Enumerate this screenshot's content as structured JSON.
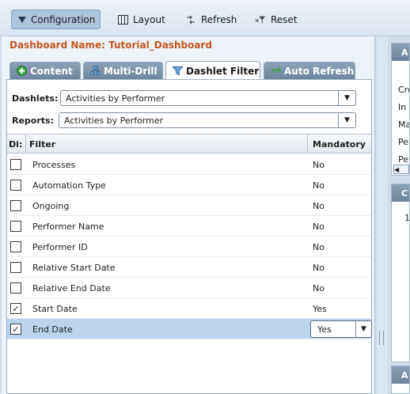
{
  "toolbar": {
    "configuration": "Configuration",
    "layout": "Layout",
    "refresh": "Refresh",
    "reset": "Reset"
  },
  "dashboard_name": "Dashboard Name: Tutorial_Dashboard",
  "tabs": [
    {
      "label": "Content"
    },
    {
      "label": "Multi-Drill"
    },
    {
      "label": "Dashlet Filter"
    },
    {
      "label": "Auto Refresh"
    }
  ],
  "form": {
    "dashlets_label": "Dashlets:",
    "dashlets_value": "Activities by Performer",
    "reports_label": "Reports:",
    "reports_value": "Activities by Performer"
  },
  "grid": {
    "col_display": "Di:",
    "col_filter": "Filter",
    "col_mandatory": "Mandatory",
    "rows": [
      {
        "filter": "Processes",
        "mandatory": "No",
        "checked": false
      },
      {
        "filter": "Automation Type",
        "mandatory": "No",
        "checked": false
      },
      {
        "filter": "Ongoing",
        "mandatory": "No",
        "checked": false
      },
      {
        "filter": "Performer Name",
        "mandatory": "No",
        "checked": false
      },
      {
        "filter": "Performer ID",
        "mandatory": "No",
        "checked": false
      },
      {
        "filter": "Relative Start Date",
        "mandatory": "No",
        "checked": false
      },
      {
        "filter": "Relative End Date",
        "mandatory": "No",
        "checked": false
      },
      {
        "filter": "Start Date",
        "mandatory": "Yes",
        "checked": true
      },
      {
        "filter": "End Date",
        "mandatory": "Yes",
        "checked": true
      }
    ]
  },
  "right_panel": {
    "head1": "A",
    "items": [
      "Cre",
      "In",
      "Ma",
      "Per",
      "Per"
    ],
    "head2": "C",
    "value": "1",
    "head3": "A"
  },
  "icons": {
    "configuration": "triangle-down-icon",
    "layout": "columns-icon",
    "refresh": "refresh-arrows-icon",
    "reset": "reset-funnel-icon",
    "content": "plus-circle-icon",
    "multi_drill": "hierarchy-icon",
    "dashlet_filter": "filter-icon",
    "auto_refresh": "auto-refresh-icon"
  },
  "colors": {
    "accent_orange": "#c4561c",
    "selected_row": "#bcd3ee",
    "tab_bg": "#7a90a7"
  }
}
